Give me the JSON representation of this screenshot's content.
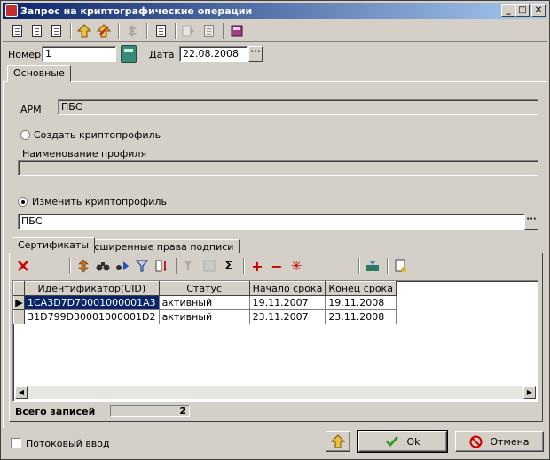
{
  "window": {
    "title": "Запрос на криптографические операции",
    "buttons": [
      "_",
      "□",
      "✕"
    ]
  },
  "header": {
    "number_label": "Номер",
    "number_value": "1",
    "date_label": "Дата",
    "date_value": "22.08.2008",
    "ellipsis": "···"
  },
  "tabs": {
    "main": "Основные",
    "certificates": "Сертификаты",
    "extended_rights": "Расширенные права подписи"
  },
  "form": {
    "arm_label": "АРМ",
    "arm_value": "ПБС",
    "create_profile_label": "Создать криптопрофиль",
    "profile_name_label": "Наименование профиля",
    "profile_name_value": "",
    "change_profile_label": "Изменить криптопрофиль",
    "change_profile_value": "ПБС",
    "selected_option": "change"
  },
  "grid": {
    "columns": [
      "Идентификатор(UID)",
      "Статус",
      "Начало срока",
      "Конец срока"
    ],
    "rows": [
      {
        "uid": "1CA3D7D70001000001A3",
        "status": "активный",
        "start": "19.11.2007",
        "end": "19.11.2008"
      },
      {
        "uid": "31D799D30001000001D2",
        "status": "активный",
        "start": "23.11.2007",
        "end": "23.11.2008"
      }
    ],
    "total_label": "Всего записей",
    "total_value": "2"
  },
  "footer": {
    "stream_input_label": "Потоковый ввод",
    "ok_label": "Ok",
    "cancel_label": "Отмена"
  },
  "colors": {
    "title_bar": "#0a246a",
    "selection": "#0a246a",
    "delete_icon": "#cc0000",
    "ok_check": "#2a9a2a"
  }
}
